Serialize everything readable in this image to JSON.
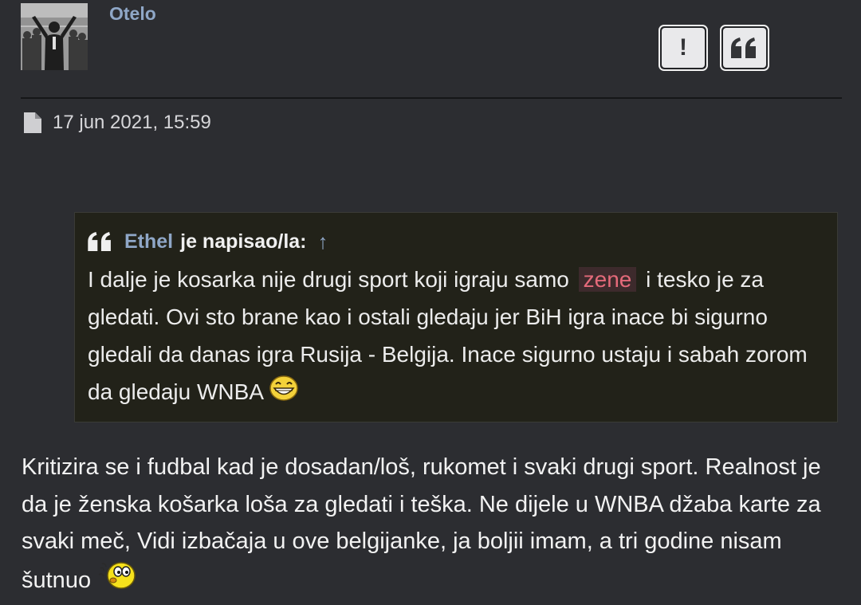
{
  "post": {
    "username": "Otelo",
    "timestamp": "17 jun 2021, 15:59",
    "actions": {
      "report_label": "!",
      "quote_icon": "quote-icon"
    },
    "avatar_icon": "user-avatar"
  },
  "quote": {
    "author": "Ethel",
    "wrote": "je napisao/la:",
    "arrow": "↑",
    "text_before": "I dalje je kosarka nije drugi sport koji igraju samo",
    "highlight": "zene",
    "text_after": "i tesko je za gledati. Ovi sto brane kao i ostali gledaju jer BiH igra inace bi sigurno gledali da danas igra Rusija - Belgija. Inace sigurno ustaju i sabah zorom da gledaju WNBA",
    "smiley": "grin-smiley-icon"
  },
  "body": {
    "text": "Kritizira se i fudbal kad je dosadan/loš, rukomet i svaki drugi sport. Realnost je da je ženska košarka loša za gledati i teška. Ne dijele u WNBA džaba karte za svaki meč, Vidi izbačaja u ove belgijanke, ja boljii imam, a tri godine nisam šutnuo",
    "smiley": "whistle-smiley-icon"
  },
  "colors": {
    "background": "#2c2d31",
    "link": "#8fa7c7",
    "quote_bg": "#222219",
    "highlight_text": "#e46a7a"
  }
}
